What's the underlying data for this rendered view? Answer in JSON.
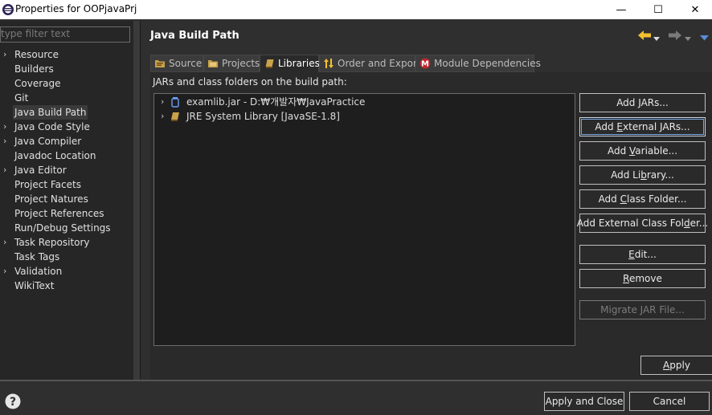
{
  "window": {
    "title": "Properties for OOPjavaPrj",
    "controls": {
      "minimize": "—",
      "maximize": "☐",
      "close": "✕"
    }
  },
  "sidebar": {
    "filter_placeholder": "type filter text",
    "items": [
      {
        "label": "Resource",
        "expandable": true
      },
      {
        "label": "Builders",
        "expandable": false
      },
      {
        "label": "Coverage",
        "expandable": false
      },
      {
        "label": "Git",
        "expandable": false
      },
      {
        "label": "Java Build Path",
        "expandable": false,
        "selected": true
      },
      {
        "label": "Java Code Style",
        "expandable": true
      },
      {
        "label": "Java Compiler",
        "expandable": true
      },
      {
        "label": "Javadoc Location",
        "expandable": false
      },
      {
        "label": "Java Editor",
        "expandable": true
      },
      {
        "label": "Project Facets",
        "expandable": false
      },
      {
        "label": "Project Natures",
        "expandable": false
      },
      {
        "label": "Project References",
        "expandable": false
      },
      {
        "label": "Run/Debug Settings",
        "expandable": false
      },
      {
        "label": "Task Repository",
        "expandable": true
      },
      {
        "label": "Task Tags",
        "expandable": false
      },
      {
        "label": "Validation",
        "expandable": true
      },
      {
        "label": "WikiText",
        "expandable": false
      }
    ]
  },
  "header": {
    "title": "Java Build Path",
    "nav_icons": [
      "back-arrow-icon",
      "dropdown-icon",
      "forward-arrow-icon",
      "dropdown-icon",
      "menu-dropdown-icon"
    ]
  },
  "tabs": [
    {
      "label": "Source",
      "icon": "source-folder-icon",
      "active": false
    },
    {
      "label": "Projects",
      "icon": "projects-folder-icon",
      "active": false
    },
    {
      "label": "Libraries",
      "icon": "library-icon",
      "active": true
    },
    {
      "label": "Order and Export",
      "icon": "order-arrows-icon",
      "active": false
    },
    {
      "label": "Module Dependencies",
      "icon": "module-icon",
      "active": false
    }
  ],
  "libraries": {
    "caption": "JARs and class folders on the build path:",
    "entries": [
      {
        "label": "examlib.jar - D:₩개발자₩JavaPractice",
        "icon": "jar-icon"
      },
      {
        "label": "JRE System Library [JavaSE-1.8]",
        "icon": "library-icon"
      }
    ],
    "buttons": [
      {
        "pre": "Add ",
        "u": "J",
        "post": "ARs...",
        "state": "normal"
      },
      {
        "pre": "Add ",
        "u": "E",
        "post": "xternal JARs...",
        "state": "focused"
      },
      {
        "pre": "Add ",
        "u": "V",
        "post": "ariable...",
        "state": "normal"
      },
      {
        "pre": "Add Li",
        "u": "b",
        "post": "rary...",
        "state": "normal"
      },
      {
        "pre": "Add ",
        "u": "C",
        "post": "lass Folder...",
        "state": "normal"
      },
      {
        "pre": "Add External Class Fol",
        "u": "d",
        "post": "er...",
        "state": "normal"
      },
      {
        "pre": "",
        "u": "E",
        "post": "dit...",
        "state": "normal"
      },
      {
        "pre": "",
        "u": "R",
        "post": "emove",
        "state": "normal"
      },
      {
        "pre": "Migrate JAR File...",
        "u": "",
        "post": "",
        "state": "disabled"
      }
    ],
    "apply": {
      "pre": "",
      "u": "A",
      "post": "pply"
    }
  },
  "footer": {
    "help_icon": "help-icon",
    "apply_close": "Apply and Close",
    "cancel": "Cancel"
  }
}
